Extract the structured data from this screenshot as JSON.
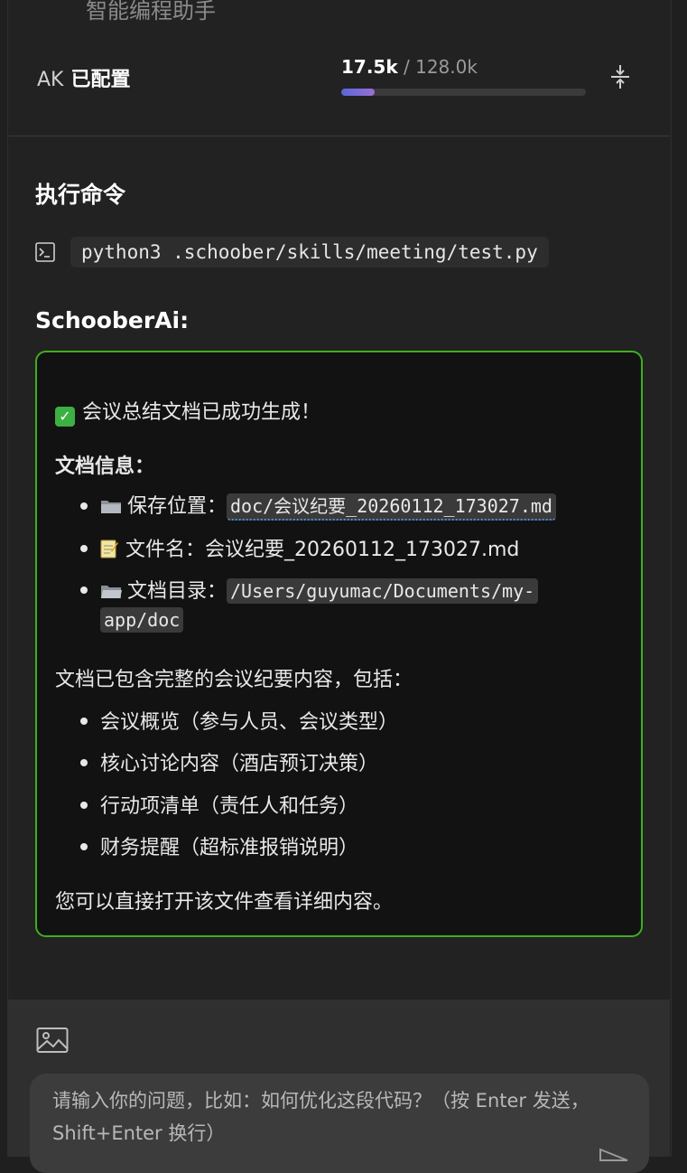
{
  "header": {
    "subtitle": "智能编程助手",
    "ak_label": "AK",
    "ak_status": "已配置",
    "tokens_used": "17.5k",
    "tokens_sep": " / ",
    "tokens_total": "128.0k",
    "token_usage_fraction": 0.137
  },
  "command": {
    "title": "执行命令",
    "text": "python3 .schoober/skills/meeting/test.py"
  },
  "assistant": {
    "name": "SchooberAi:",
    "success_line": "会议总结文档已成功生成！",
    "doc_info_title": "文档信息：",
    "save_location_label": "保存位置：",
    "save_location_value": "doc/会议纪要_20260112_173027.md",
    "file_name_label": "文件名：",
    "file_name_value": "会议纪要_20260112_173027.md",
    "doc_dir_label": "文档目录：",
    "doc_dir_value_1": "/Users/guyumac/Documents/my-",
    "doc_dir_value_2": "app/doc",
    "contents_intro": "文档已包含完整的会议纪要内容，包括：",
    "contents": [
      "会议概览（参与人员、会议类型）",
      "核心讨论内容（酒店预订决策）",
      "行动项清单（责任人和任务）",
      "财务提醒（超标准报销说明）"
    ],
    "closing": "您可以直接打开该文件查看详细内容。"
  },
  "input": {
    "placeholder": "请输入你的问题，比如：如何优化这段代码？（按 Enter 发送，Shift+Enter 换行）"
  },
  "colors": {
    "accent_border": "#3fae1f",
    "progress_fill": "#7a6ad6",
    "link_underline": "#4a8ee0"
  }
}
